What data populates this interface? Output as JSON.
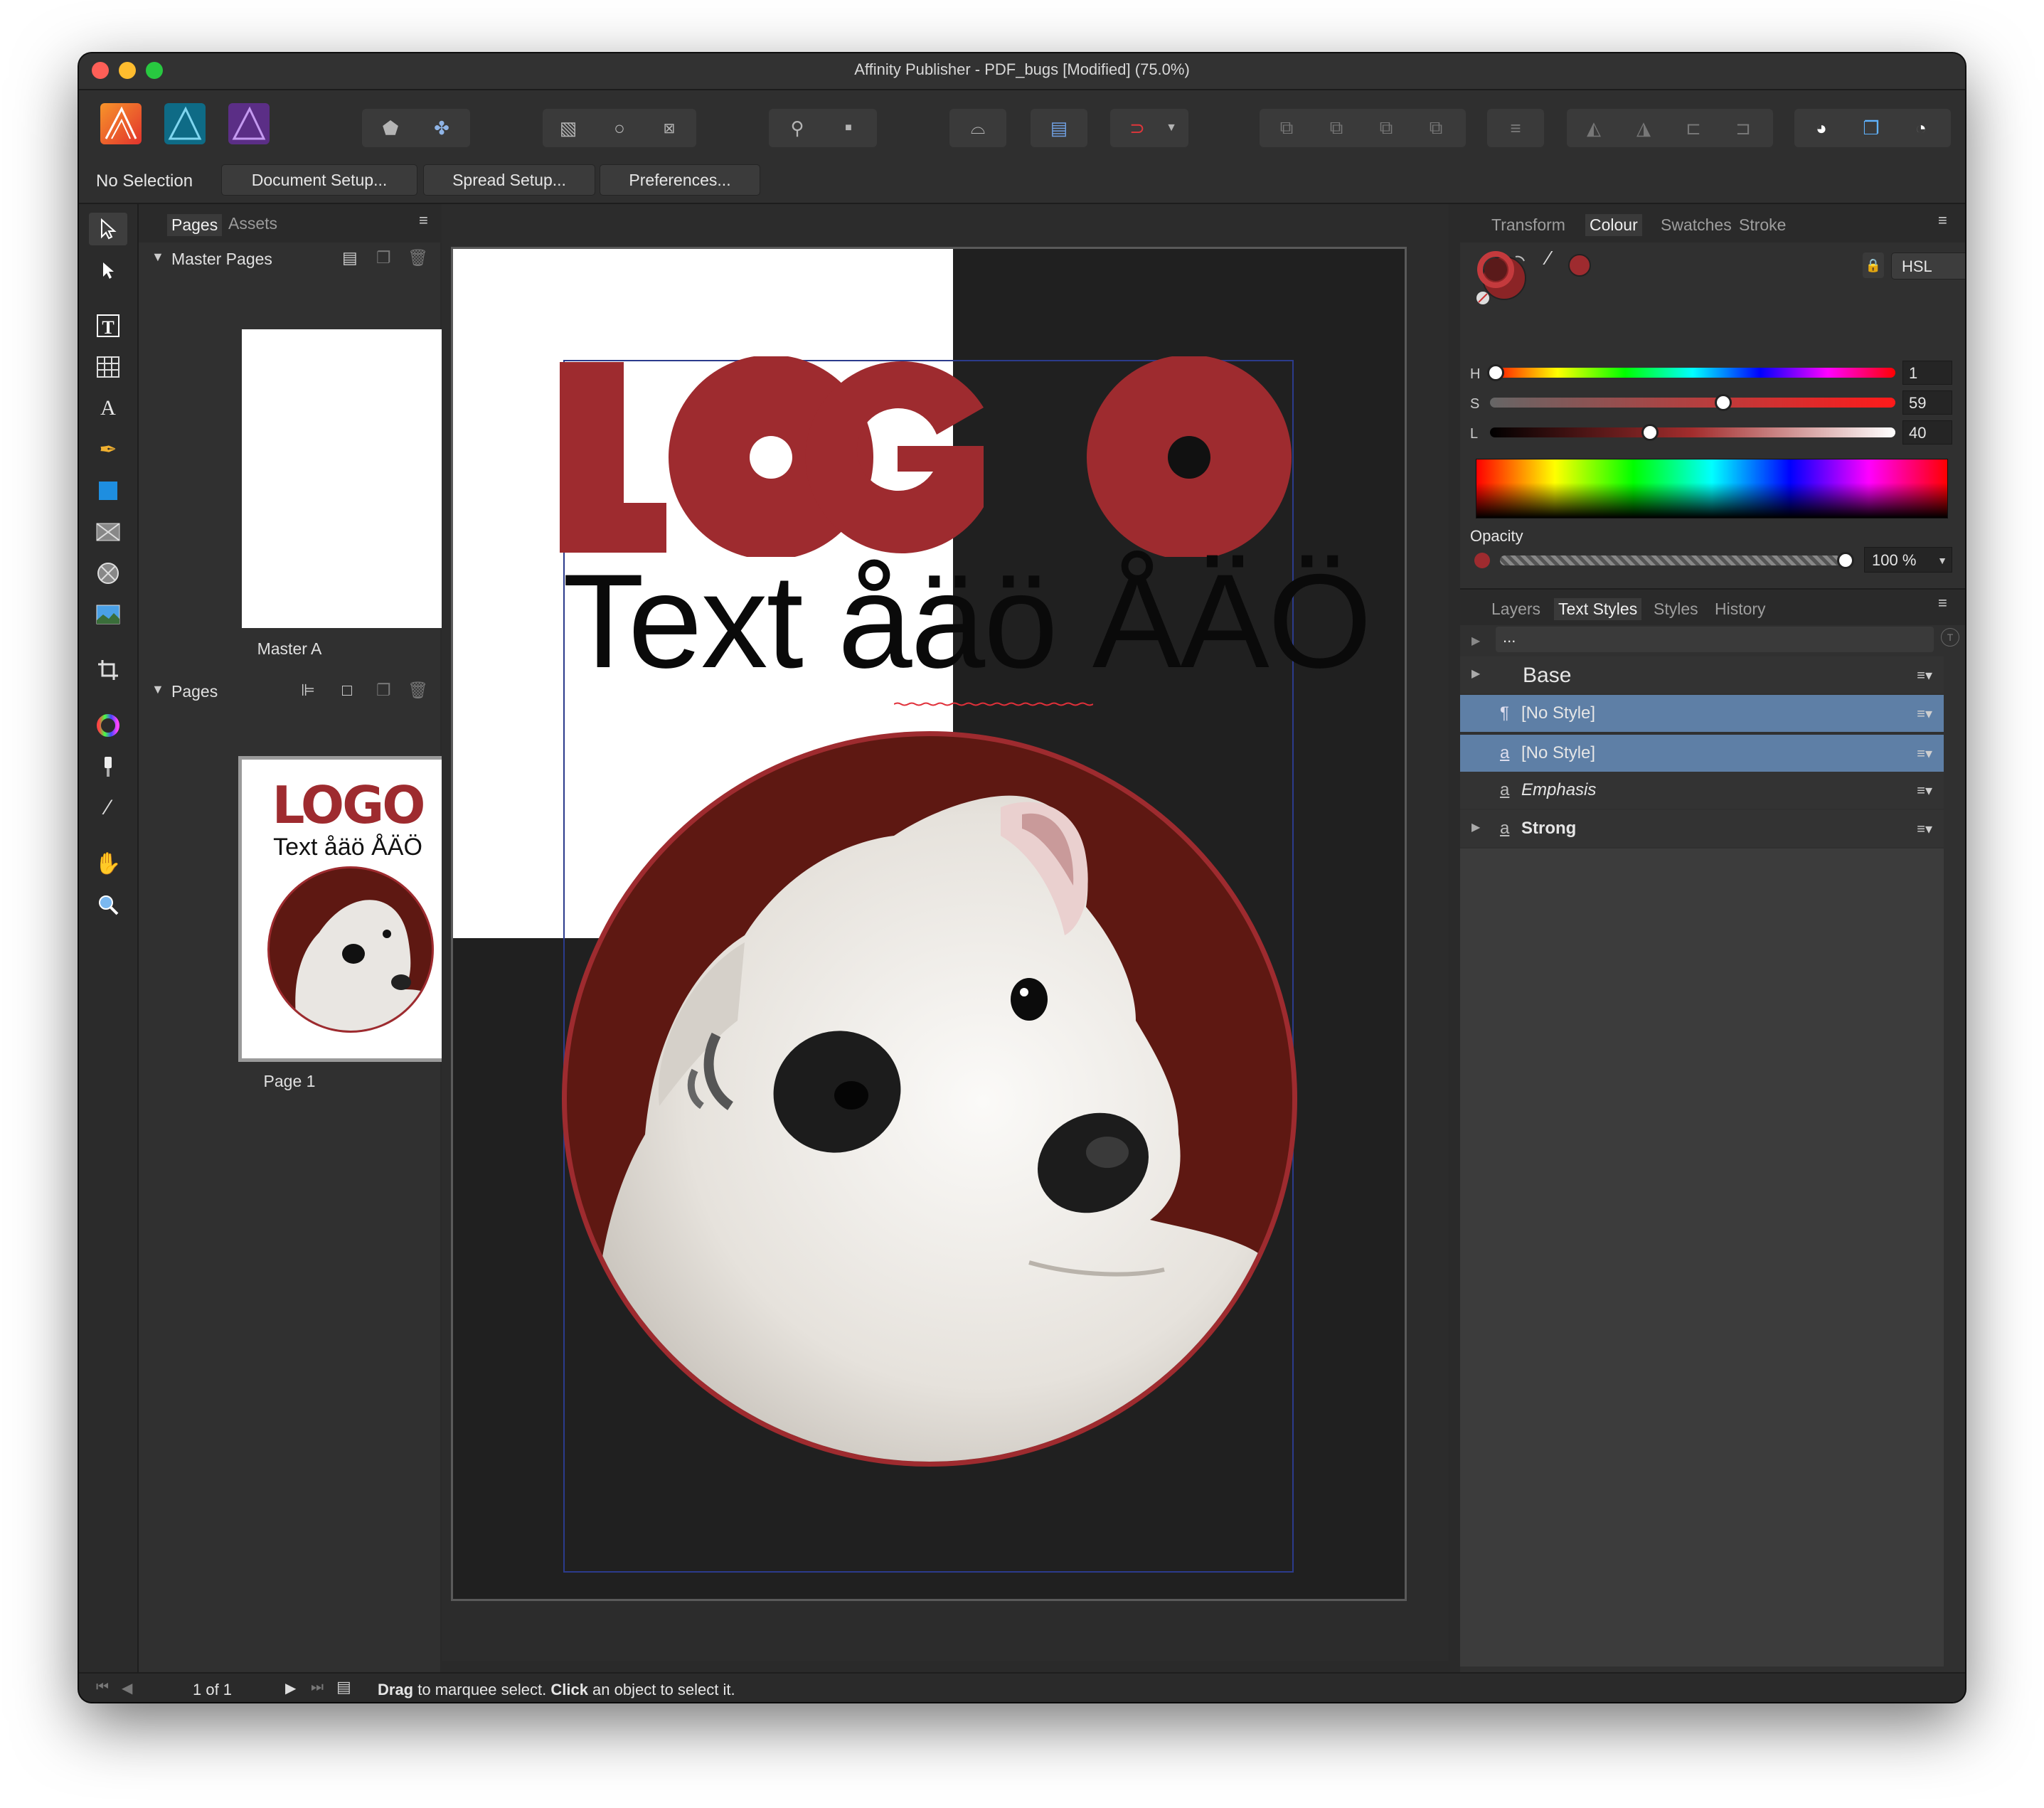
{
  "window": {
    "title": "Affinity Publisher - PDF_bugs [Modified] (75.0%)",
    "traffic_lights": [
      "#fe5f57",
      "#febc2e",
      "#28c840"
    ]
  },
  "context_bar": {
    "selection": "No Selection",
    "buttons": [
      "Document Setup...",
      "Spread Setup...",
      "Preferences..."
    ]
  },
  "pages_panel": {
    "tabs": [
      "Pages",
      "Assets"
    ],
    "master_section": "Master Pages",
    "master_caption": "Master A",
    "pages_section": "Pages",
    "page_caption": "Page 1",
    "thumb_logo": "LOGO",
    "thumb_text": "Text åäö ÅÄÖ"
  },
  "document": {
    "logo": "LOGO",
    "text": "Text åäö ÅÄÖ",
    "accent_color": "#9e2b2f",
    "circle_fill": "#5e1812"
  },
  "colour_panel": {
    "tabs": [
      "Transform",
      "Colour",
      "Swatches",
      "Stroke"
    ],
    "active_tab": "Colour",
    "model": "HSL",
    "h_label": "H",
    "h_value": "1",
    "s_label": "S",
    "s_value": "59",
    "l_label": "L",
    "l_value": "40",
    "opacity_label": "Opacity",
    "opacity_value": "100 %"
  },
  "text_styles_panel": {
    "tabs": [
      "Layers",
      "Text Styles",
      "Styles",
      "History"
    ],
    "active_tab": "Text Styles",
    "filter": "...",
    "group": "Base",
    "rows": [
      {
        "glyph": "¶",
        "label": "[No Style]",
        "selected": true
      },
      {
        "glyph": "a",
        "label": "[No Style]",
        "selected": true
      },
      {
        "glyph": "a",
        "label": "Emphasis",
        "selected": false
      },
      {
        "glyph": "a",
        "label": "Strong",
        "selected": false
      }
    ]
  },
  "status": {
    "page_counter": "1 of 1",
    "hint_b1": "Drag",
    "hint_t1": " to marquee select. ",
    "hint_b2": "Click",
    "hint_t2": " an object to select it."
  }
}
